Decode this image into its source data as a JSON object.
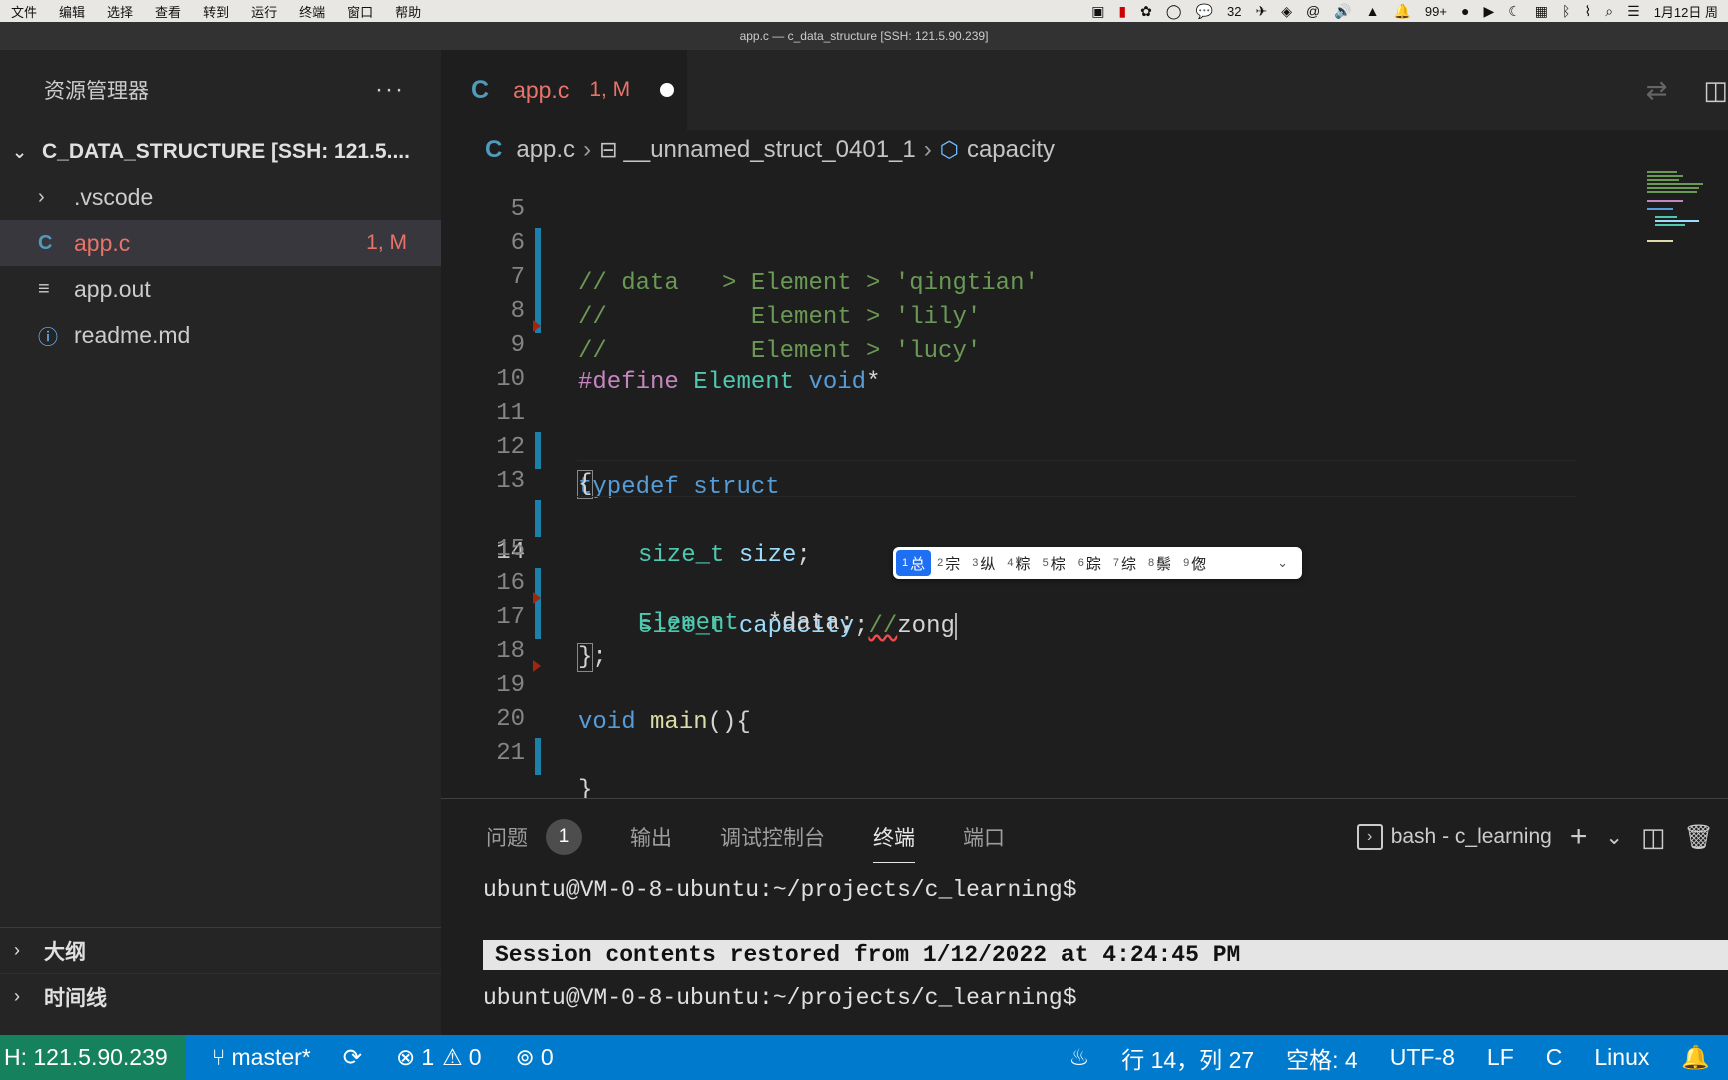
{
  "menubar": {
    "items": [
      "文件",
      "编辑",
      "选择",
      "查看",
      "转到",
      "运行",
      "终端",
      "窗口",
      "帮助"
    ],
    "tray_wechat_count": "32",
    "tray_qq_count": "99+",
    "date": "1月12日 周"
  },
  "window": {
    "title": "app.c — c_data_structure [SSH: 121.5.90.239]"
  },
  "sidebar": {
    "title": "资源管理器",
    "more": "···",
    "root": "C_DATA_STRUCTURE [SSH: 121.5....",
    "items": [
      {
        "label": ".vscode",
        "icon": "chevron-right-icon"
      },
      {
        "label": "app.c",
        "icon": "c-file-icon",
        "badge": "1, M"
      },
      {
        "label": "app.out",
        "icon": "text-file-icon"
      },
      {
        "label": "readme.md",
        "icon": "info-icon"
      }
    ],
    "outline": "大纲",
    "timeline": "时间线"
  },
  "tab": {
    "icon": "C",
    "name": "app.c",
    "status": "1, M"
  },
  "breadcrumb": {
    "icon": "C",
    "file": "app.c",
    "struct": "__unnamed_struct_0401_1",
    "field": "capacity"
  },
  "editor": {
    "line_numbers": [
      "5",
      "6",
      "7",
      "8",
      "9",
      "10",
      "11",
      "12",
      "13",
      "14",
      "15",
      "16",
      "17",
      "18",
      "19",
      "20",
      "21"
    ],
    "lines": {
      "l5": "// data   > Element > 'qingtian'",
      "l6": "//          Element > 'lily'",
      "l7": "//          Element > 'lucy'",
      "l9_a": "#define",
      "l9_b": " Element ",
      "l9_c": "void",
      "l9_d": "*",
      "l11_a": "typedef",
      "l11_b": " struct",
      "l12": "{",
      "l13_a": "size_t",
      "l13_b": " size",
      "l13_c": ";",
      "l14_a": "size_t",
      "l14_b": " capacity",
      "l14_c": ";",
      "l14_d": "//",
      "l14_e": "zong",
      "l15_a": "Element",
      "l15_b": "  *data;",
      "l16_a": "}",
      "l16_b": ";",
      "l19_a": "void",
      "l19_b": " main",
      "l19_c": "(){",
      "l21": "}"
    }
  },
  "ime": {
    "candidates": [
      {
        "n": "1",
        "ch": "总"
      },
      {
        "n": "2",
        "ch": "宗"
      },
      {
        "n": "3",
        "ch": "纵"
      },
      {
        "n": "4",
        "ch": "粽"
      },
      {
        "n": "5",
        "ch": "棕"
      },
      {
        "n": "6",
        "ch": "踪"
      },
      {
        "n": "7",
        "ch": "综"
      },
      {
        "n": "8",
        "ch": "鬃"
      },
      {
        "n": "9",
        "ch": "偬"
      }
    ]
  },
  "panel": {
    "tabs": {
      "problems": "问题",
      "problems_count": "1",
      "output": "输出",
      "debug": "调试控制台",
      "terminal": "终端",
      "ports": "端口"
    },
    "terminal_name": "bash - c_learning",
    "terminal": {
      "prompt1": "ubuntu@VM-0-8-ubuntu:~/projects/c_learning$",
      "restored": "Session contents restored from 1/12/2022 at 4:24:45 PM",
      "prompt2": "ubuntu@VM-0-8-ubuntu:~/projects/c_learning$"
    }
  },
  "statusbar": {
    "remote": "H: 121.5.90.239",
    "branch": "master*",
    "errors": "1",
    "warnings": "0",
    "ports": "0",
    "position": "行 14，列 27",
    "spaces": "空格: 4",
    "encoding": "UTF-8",
    "eol": "LF",
    "language": "C",
    "platform": "Linux"
  },
  "colors": {
    "statusbar": "#007acc",
    "remote": "#16825d",
    "modified": "#e8736a",
    "gutter_change": "#1b81a8"
  }
}
